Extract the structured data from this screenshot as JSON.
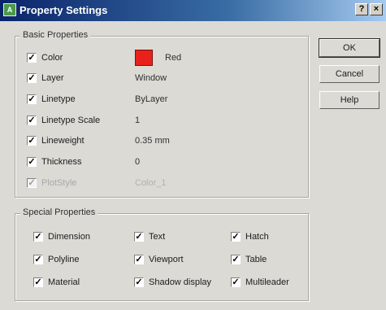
{
  "window": {
    "title": "Property Settings",
    "help_glyph": "?",
    "close_glyph": "×",
    "icon_text": "A"
  },
  "basic": {
    "title": "Basic Properties",
    "items": [
      {
        "label": "Color",
        "value": "Red",
        "checked": true,
        "enabled": true,
        "swatch_color": "#e8221b"
      },
      {
        "label": "Layer",
        "value": "Window",
        "checked": true,
        "enabled": true
      },
      {
        "label": "Linetype",
        "value": "ByLayer",
        "checked": true,
        "enabled": true
      },
      {
        "label": "Linetype Scale",
        "value": "1",
        "checked": true,
        "enabled": true
      },
      {
        "label": "Lineweight",
        "value": "0.35 mm",
        "checked": true,
        "enabled": true
      },
      {
        "label": "Thickness",
        "value": "0",
        "checked": true,
        "enabled": true
      },
      {
        "label": "PlotStyle",
        "value": "Color_1",
        "checked": true,
        "enabled": false
      }
    ]
  },
  "special": {
    "title": "Special Properties",
    "items": [
      {
        "label": "Dimension",
        "checked": true
      },
      {
        "label": "Text",
        "checked": true
      },
      {
        "label": "Hatch",
        "checked": true
      },
      {
        "label": "Polyline",
        "checked": true
      },
      {
        "label": "Viewport",
        "checked": true
      },
      {
        "label": "Table",
        "checked": true
      },
      {
        "label": "Material",
        "checked": true
      },
      {
        "label": "Shadow display",
        "checked": true
      },
      {
        "label": "Multileader",
        "checked": true
      }
    ]
  },
  "buttons": {
    "ok": "OK",
    "cancel": "Cancel",
    "help": "Help"
  },
  "check_glyph": "✓"
}
